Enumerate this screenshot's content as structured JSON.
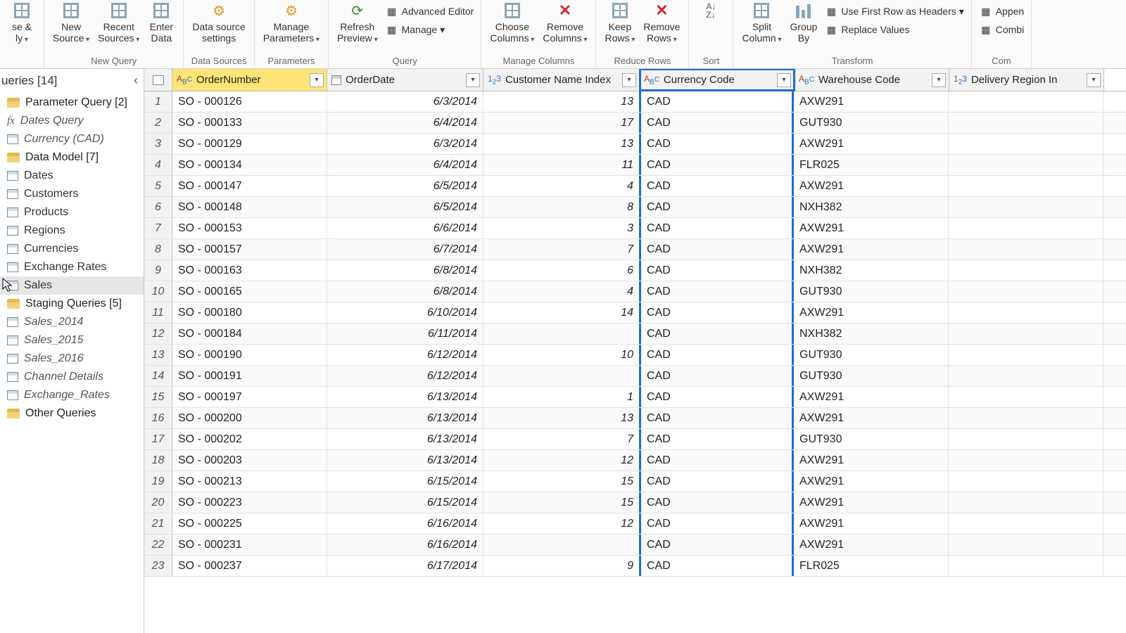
{
  "ribbon": {
    "groups": [
      {
        "label": "",
        "buttons": [
          {
            "name": "close-apply",
            "label": "se &\nly",
            "drop": true
          }
        ]
      },
      {
        "label": "New Query",
        "buttons": [
          {
            "name": "new-source",
            "label": "New\nSource",
            "drop": true
          },
          {
            "name": "recent-sources",
            "label": "Recent\nSources",
            "drop": true
          },
          {
            "name": "enter-data",
            "label": "Enter\nData"
          }
        ]
      },
      {
        "label": "Data Sources",
        "buttons": [
          {
            "name": "data-source-settings",
            "label": "Data source\nsettings"
          }
        ]
      },
      {
        "label": "Parameters",
        "buttons": [
          {
            "name": "manage-parameters",
            "label": "Manage\nParameters",
            "drop": true
          }
        ]
      },
      {
        "label": "Query",
        "buttons": [
          {
            "name": "refresh-preview",
            "label": "Refresh\nPreview",
            "drop": true
          }
        ],
        "side": [
          {
            "name": "advanced-editor",
            "label": "Advanced Editor"
          },
          {
            "name": "manage",
            "label": "Manage",
            "drop": true
          }
        ]
      },
      {
        "label": "Manage Columns",
        "buttons": [
          {
            "name": "choose-columns",
            "label": "Choose\nColumns",
            "drop": true
          },
          {
            "name": "remove-columns",
            "label": "Remove\nColumns",
            "drop": true
          }
        ]
      },
      {
        "label": "Reduce Rows",
        "buttons": [
          {
            "name": "keep-rows",
            "label": "Keep\nRows",
            "drop": true
          },
          {
            "name": "remove-rows",
            "label": "Remove\nRows",
            "drop": true
          }
        ]
      },
      {
        "label": "Sort",
        "buttons": [
          {
            "name": "sort",
            "label": ""
          }
        ]
      },
      {
        "label": "Transform",
        "buttons": [
          {
            "name": "split-column",
            "label": "Split\nColumn",
            "drop": true
          },
          {
            "name": "group-by",
            "label": "Group\nBy"
          }
        ],
        "side": [
          {
            "name": "first-row-headers",
            "label": "Use First Row as Headers",
            "drop": true
          },
          {
            "name": "replace-values",
            "label": "Replace Values"
          }
        ]
      },
      {
        "label": "Com",
        "buttons": [],
        "side": [
          {
            "name": "append",
            "label": "Appen"
          },
          {
            "name": "combine",
            "label": "Combi"
          }
        ]
      }
    ]
  },
  "queries": {
    "header": "ueries [14]",
    "groups": [
      {
        "type": "folder",
        "label": "Parameter Query [2]",
        "name": "folder-parameter-query"
      },
      {
        "type": "fx",
        "label": "Dates Query",
        "name": "query-dates-query",
        "ital": true
      },
      {
        "type": "tbl",
        "label": "Currency (CAD)",
        "name": "query-currency-cad",
        "ital": true
      },
      {
        "type": "folder",
        "label": "Data Model [7]",
        "name": "folder-data-model"
      },
      {
        "type": "tbl",
        "label": "Dates",
        "name": "query-dates"
      },
      {
        "type": "tbl",
        "label": "Customers",
        "name": "query-customers"
      },
      {
        "type": "tbl",
        "label": "Products",
        "name": "query-products"
      },
      {
        "type": "tbl",
        "label": "Regions",
        "name": "query-regions"
      },
      {
        "type": "tbl",
        "label": "Currencies",
        "name": "query-currencies"
      },
      {
        "type": "tbl",
        "label": "Exchange Rates",
        "name": "query-exchange-rates"
      },
      {
        "type": "tbl",
        "label": "Sales",
        "name": "query-sales",
        "sel": true
      },
      {
        "type": "folder",
        "label": "Staging Queries [5]",
        "name": "folder-staging-queries"
      },
      {
        "type": "tbl",
        "label": "Sales_2014",
        "name": "query-sales-2014",
        "ital": true
      },
      {
        "type": "tbl",
        "label": "Sales_2015",
        "name": "query-sales-2015",
        "ital": true
      },
      {
        "type": "tbl",
        "label": "Sales_2016",
        "name": "query-sales-2016",
        "ital": true
      },
      {
        "type": "tbl",
        "label": "Channel Details",
        "name": "query-channel-details",
        "ital": true
      },
      {
        "type": "tbl",
        "label": "Exchange_Rates",
        "name": "query-exchange-rates-stg",
        "ital": true
      },
      {
        "type": "folder",
        "label": "Other Queries",
        "name": "folder-other-queries"
      }
    ]
  },
  "columns": [
    {
      "name": "OrderNumber",
      "type": "abc",
      "sel": true
    },
    {
      "name": "OrderDate",
      "type": "date"
    },
    {
      "name": "Customer Name Index",
      "type": "123"
    },
    {
      "name": "Currency Code",
      "type": "abc",
      "hl": true,
      "filtered": true
    },
    {
      "name": "Warehouse Code",
      "type": "abc"
    },
    {
      "name": "Delivery Region In",
      "type": "123"
    }
  ],
  "rows": [
    {
      "n": 1,
      "on": "SO - 000126",
      "od": "6/3/2014",
      "ci": "13",
      "cc": "CAD",
      "wc": "AXW291"
    },
    {
      "n": 2,
      "on": "SO - 000133",
      "od": "6/4/2014",
      "ci": "17",
      "cc": "CAD",
      "wc": "GUT930"
    },
    {
      "n": 3,
      "on": "SO - 000129",
      "od": "6/3/2014",
      "ci": "13",
      "cc": "CAD",
      "wc": "AXW291"
    },
    {
      "n": 4,
      "on": "SO - 000134",
      "od": "6/4/2014",
      "ci": "11",
      "cc": "CAD",
      "wc": "FLR025"
    },
    {
      "n": 5,
      "on": "SO - 000147",
      "od": "6/5/2014",
      "ci": "4",
      "cc": "CAD",
      "wc": "AXW291"
    },
    {
      "n": 6,
      "on": "SO - 000148",
      "od": "6/5/2014",
      "ci": "8",
      "cc": "CAD",
      "wc": "NXH382"
    },
    {
      "n": 7,
      "on": "SO - 000153",
      "od": "6/6/2014",
      "ci": "3",
      "cc": "CAD",
      "wc": "AXW291"
    },
    {
      "n": 8,
      "on": "SO - 000157",
      "od": "6/7/2014",
      "ci": "7",
      "cc": "CAD",
      "wc": "AXW291"
    },
    {
      "n": 9,
      "on": "SO - 000163",
      "od": "6/8/2014",
      "ci": "6",
      "cc": "CAD",
      "wc": "NXH382"
    },
    {
      "n": 10,
      "on": "SO - 000165",
      "od": "6/8/2014",
      "ci": "4",
      "cc": "CAD",
      "wc": "GUT930"
    },
    {
      "n": 11,
      "on": "SO - 000180",
      "od": "6/10/2014",
      "ci": "14",
      "cc": "CAD",
      "wc": "AXW291"
    },
    {
      "n": 12,
      "on": "SO - 000184",
      "od": "6/11/2014",
      "ci": "",
      "cc": "CAD",
      "wc": "NXH382"
    },
    {
      "n": 13,
      "on": "SO - 000190",
      "od": "6/12/2014",
      "ci": "10",
      "cc": "CAD",
      "wc": "GUT930"
    },
    {
      "n": 14,
      "on": "SO - 000191",
      "od": "6/12/2014",
      "ci": "",
      "cc": "CAD",
      "wc": "GUT930"
    },
    {
      "n": 15,
      "on": "SO - 000197",
      "od": "6/13/2014",
      "ci": "1",
      "cc": "CAD",
      "wc": "AXW291"
    },
    {
      "n": 16,
      "on": "SO - 000200",
      "od": "6/13/2014",
      "ci": "13",
      "cc": "CAD",
      "wc": "AXW291"
    },
    {
      "n": 17,
      "on": "SO - 000202",
      "od": "6/13/2014",
      "ci": "7",
      "cc": "CAD",
      "wc": "GUT930"
    },
    {
      "n": 18,
      "on": "SO - 000203",
      "od": "6/13/2014",
      "ci": "12",
      "cc": "CAD",
      "wc": "AXW291"
    },
    {
      "n": 19,
      "on": "SO - 000213",
      "od": "6/15/2014",
      "ci": "15",
      "cc": "CAD",
      "wc": "AXW291"
    },
    {
      "n": 20,
      "on": "SO - 000223",
      "od": "6/15/2014",
      "ci": "15",
      "cc": "CAD",
      "wc": "AXW291"
    },
    {
      "n": 21,
      "on": "SO - 000225",
      "od": "6/16/2014",
      "ci": "12",
      "cc": "CAD",
      "wc": "AXW291"
    },
    {
      "n": 22,
      "on": "SO - 000231",
      "od": "6/16/2014",
      "ci": "",
      "cc": "CAD",
      "wc": "AXW291"
    },
    {
      "n": 23,
      "on": "SO - 000237",
      "od": "6/17/2014",
      "ci": "9",
      "cc": "CAD",
      "wc": "FLR025"
    }
  ]
}
